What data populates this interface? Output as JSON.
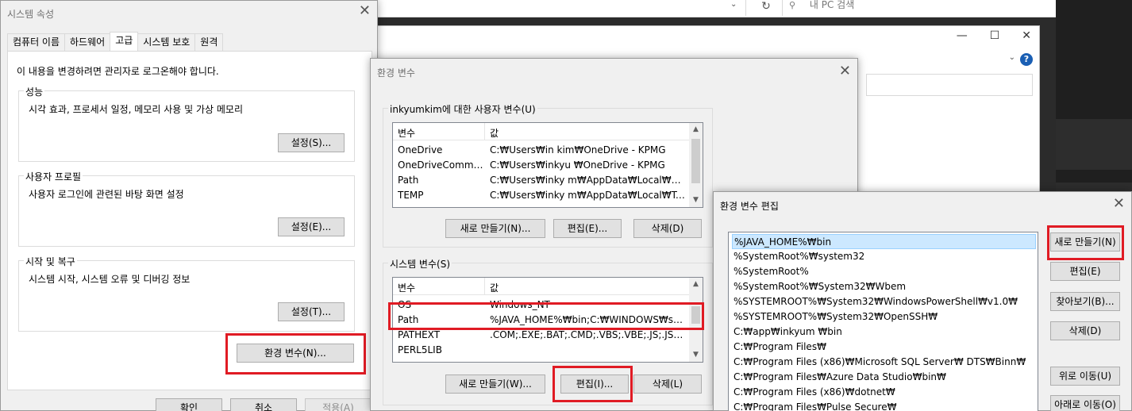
{
  "explorer": {
    "search_placeholder": "내 PC 검색",
    "refresh_icon": "refresh-icon",
    "chevron_icon": "chevron-down-icon"
  },
  "window2": {
    "help_label": "?",
    "minimize": "—",
    "maximize": "☐",
    "close": "✕"
  },
  "system_properties": {
    "title": "시스템 속성",
    "close": "✕",
    "tabs": [
      "컴퓨터 이름",
      "하드웨어",
      "고급",
      "시스템 보호",
      "원격"
    ],
    "active_tab": "고급",
    "admin_note": "이 내용을 변경하려면 관리자로 로그온해야 합니다.",
    "performance": {
      "label": "성능",
      "desc": "시각 효과, 프로세서 일정, 메모리 사용 및 가상 메모리",
      "button": "설정(S)..."
    },
    "user_profile": {
      "label": "사용자 프로필",
      "desc": "사용자 로그인에 관련된 바탕 화면 설정",
      "button": "설정(E)..."
    },
    "startup_recovery": {
      "label": "시작 및 복구",
      "desc": "시스템 시작, 시스템 오류 및 디버깅 정보",
      "button": "설정(T)..."
    },
    "env_button": "환경 변수(N)...",
    "ok": "확인",
    "cancel": "취소",
    "apply": "적용(A)"
  },
  "env_vars": {
    "title": "환경 변수",
    "close": "✕",
    "user_group_label": "inkyumkim에 대한 사용자 변수(U)",
    "col_variable": "변수",
    "col_value": "값",
    "user_rows": [
      {
        "name": "OneDrive",
        "value": "C:₩Users₩in      kim₩OneDrive - KPMG"
      },
      {
        "name": "OneDriveCommer...",
        "value": "C:₩Users₩inkyu      ₩OneDrive - KPMG"
      },
      {
        "name": "Path",
        "value": "C:₩Users₩inky      m₩AppData₩Local₩Mi..."
      },
      {
        "name": "TEMP",
        "value": "C:₩Users₩inky      m₩AppData₩Local₩Te..."
      }
    ],
    "user_new": "새로 만들기(N)...",
    "user_edit": "편집(E)...",
    "user_delete": "삭제(D)",
    "system_group_label": "시스템 변수(S)",
    "system_rows": [
      {
        "name": "OS",
        "value": "Windows_NT"
      },
      {
        "name": "Path",
        "value": "%JAVA_HOME%₩bin;C:₩WINDOWS₩syste..."
      },
      {
        "name": "PATHEXT",
        "value": ".COM;.EXE;.BAT;.CMD;.VBS;.VBE;.JS;.JSE;.W..."
      },
      {
        "name": "PERL5LIB",
        "value": ""
      }
    ],
    "system_new": "새로 만들기(W)...",
    "system_edit": "편집(I)...",
    "system_delete": "삭제(L)"
  },
  "edit_env": {
    "title": "환경 변수 편집",
    "close": "✕",
    "items": [
      "%JAVA_HOME%₩bin",
      "%SystemRoot%₩system32",
      "%SystemRoot%",
      "%SystemRoot%₩System32₩Wbem",
      "%SYSTEMROOT%₩System32₩WindowsPowerShell₩v1.0₩",
      "%SYSTEMROOT%₩System32₩OpenSSH₩",
      "C:₩app₩inkyum      ₩bin",
      "C:₩Program Files₩",
      "C:₩Program Files (x86)₩Microsoft SQL Server₩ DTS₩Binn₩",
      "C:₩Program Files₩Azure Data Studio₩bin₩",
      "C:₩Program Files (x86)₩dotnet₩",
      "C:₩Program Files₩Pulse Secure₩"
    ],
    "selected_index": 0,
    "new": "새로 만들기(N)",
    "edit": "편집(E)",
    "browse": "찾아보기(B)...",
    "delete": "삭제(D)",
    "move_up": "위로 이동(U)",
    "move_down": "아래로 이동(O)"
  },
  "colors": {
    "highlight": "#e01b24",
    "selection": "#cce8ff"
  }
}
